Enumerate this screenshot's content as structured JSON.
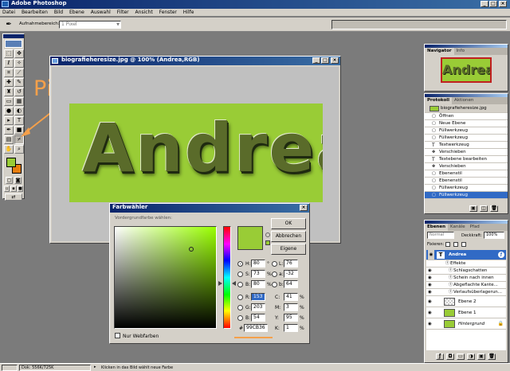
{
  "app": {
    "title": "Adobe Photoshop",
    "accent": "#0a246a"
  },
  "menubar": {
    "items": [
      "Datei",
      "Bearbeiten",
      "Bild",
      "Ebene",
      "Auswahl",
      "Filter",
      "Ansicht",
      "Fenster",
      "Hilfe"
    ]
  },
  "options_bar": {
    "label": "Aufnahmebereich:",
    "value": "1 Pixel"
  },
  "annotation": {
    "text": "Pipetta",
    "color": "#f5a04a"
  },
  "document": {
    "title": "biografieheresize.jpg @ 100% (Andrea,RGB)",
    "canvas_text": "Andrea",
    "canvas_color": "#99cc36"
  },
  "navigator": {
    "tabs": [
      "Navigator",
      "Info"
    ],
    "preview_text": "Andrea"
  },
  "history": {
    "tabs": [
      "Protokoll",
      "Aktionen"
    ],
    "snapshot": "biografieheresize.jpg",
    "items": [
      "Öffnen",
      "Neue Ebene",
      "Füllwerkzeug",
      "Füllwerkzeug",
      "Textwerkzeug",
      "Verschieben",
      "Textebene bearbeiten",
      "Verschieben",
      "Ebenenstil",
      "Ebenenstil",
      "Füllwerkzeug",
      "Füllwerkzeug"
    ]
  },
  "layers": {
    "tabs": [
      "Ebenen",
      "Kanäle",
      "Pfad"
    ],
    "blend_mode": "Normal",
    "opacity_label": "Deckkraft:",
    "opacity_value": "100%",
    "lock_label": "Fixieren:",
    "rows": [
      {
        "name": "Andrea",
        "type": "text",
        "selected": true
      },
      {
        "name": "Effekte",
        "type": "effect-header"
      },
      {
        "name": "Schlagschatten",
        "type": "effect"
      },
      {
        "name": "Schein nach innen",
        "type": "effect"
      },
      {
        "name": "Abgeflachte Kante...",
        "type": "effect"
      },
      {
        "name": "Verlaufsüberlagerun...",
        "type": "effect"
      },
      {
        "name": "Ebene 2",
        "type": "layer"
      },
      {
        "name": "Ebene 1",
        "type": "layer"
      },
      {
        "name": "Hintergrund",
        "type": "background"
      }
    ]
  },
  "color_picker": {
    "title": "Farbwähler",
    "subtitle": "Vordergrundfarbe wählen:",
    "ok": "OK",
    "cancel": "Abbrechen",
    "custom": "Eigene",
    "web_colors": "Nur Webfarben",
    "color": "#99cc36",
    "fields": {
      "H": {
        "value": "80",
        "unit": "°"
      },
      "S": {
        "value": "73",
        "unit": "%"
      },
      "Bv": {
        "value": "80",
        "unit": "%"
      },
      "R": {
        "value": "153",
        "unit": ""
      },
      "G": {
        "value": "203",
        "unit": ""
      },
      "B": {
        "value": "54",
        "unit": ""
      },
      "L": {
        "value": "76",
        "unit": ""
      },
      "a": {
        "value": "-32",
        "unit": ""
      },
      "b": {
        "value": "64",
        "unit": ""
      },
      "C": {
        "value": "41",
        "unit": "%"
      },
      "M": {
        "value": "3",
        "unit": "%"
      },
      "Y": {
        "value": "95",
        "unit": "%"
      },
      "K": {
        "value": "1",
        "unit": "%"
      }
    },
    "hex_label": "#",
    "hex": "99CB36"
  },
  "statusbar": {
    "doc_info": "Dok: 556K/725K",
    "hint": "Klicken in das Bild wählt neue Farbe"
  },
  "toolbox": {
    "tools": [
      "marquee",
      "move",
      "lasso",
      "magic-wand",
      "crop",
      "slice",
      "healing",
      "brush",
      "stamp",
      "history-brush",
      "eraser",
      "gradient",
      "blur",
      "dodge",
      "path-select",
      "type",
      "pen",
      "shape",
      "notes",
      "eyedropper",
      "hand",
      "zoom"
    ],
    "fg_color": "#99cc36",
    "bg_color": "#e87e0e"
  }
}
